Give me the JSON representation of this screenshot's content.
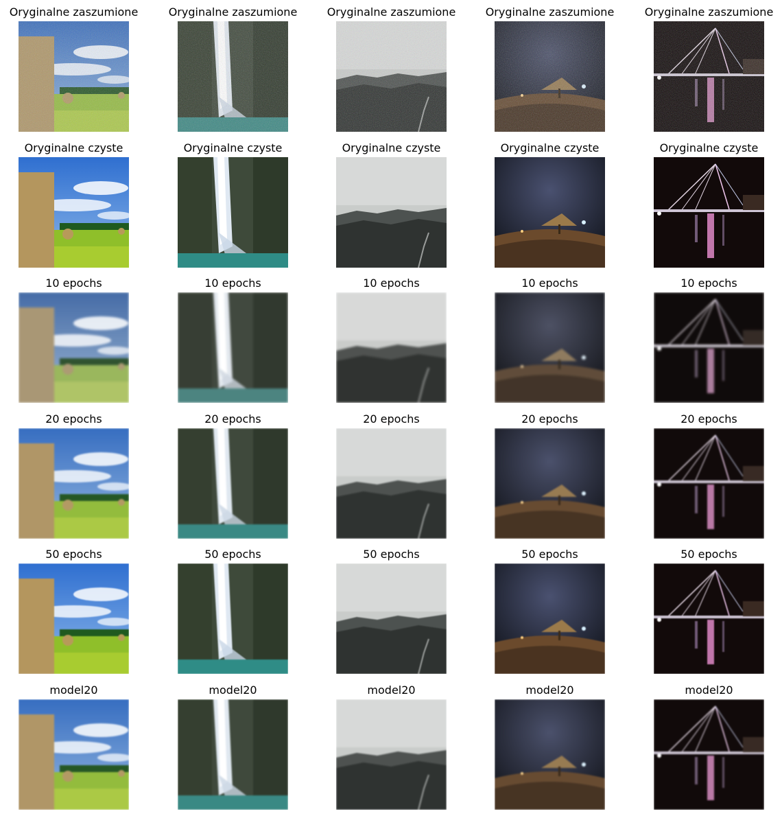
{
  "rows": [
    {
      "title": "Oryginalne zaszumione",
      "variant": "noisy"
    },
    {
      "title": "Oryginalne czyste",
      "variant": "clean"
    },
    {
      "title": "10 epochs",
      "variant": "blur10"
    },
    {
      "title": "20 epochs",
      "variant": "blur20"
    },
    {
      "title": "50 epochs",
      "variant": "blur50"
    },
    {
      "title": "model20",
      "variant": "blur20"
    }
  ],
  "columns": [
    {
      "scene": "hay-field"
    },
    {
      "scene": "waterfall"
    },
    {
      "scene": "misty-hills"
    },
    {
      "scene": "night-hut"
    },
    {
      "scene": "night-bridge"
    }
  ]
}
